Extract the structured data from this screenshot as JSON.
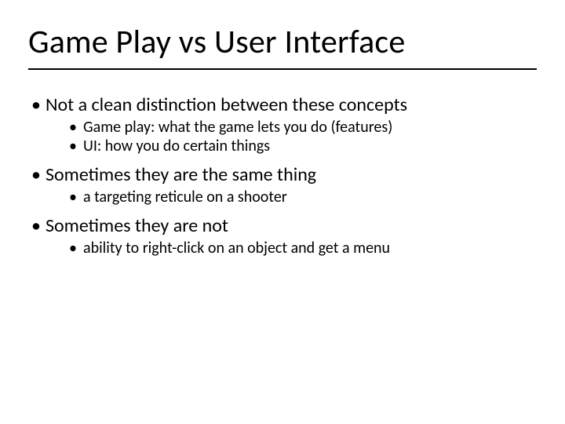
{
  "title": "Game Play vs User Interface",
  "bullets": [
    {
      "text": "Not a clean distinction between these concepts",
      "sub": [
        "Game play:  what the game lets you do (features)",
        " UI:  how you do certain things"
      ]
    },
    {
      "text": "Sometimes they are the same thing",
      "sub": [
        "a targeting reticule on a shooter"
      ]
    },
    {
      "text": "Sometimes they are not",
      "sub": [
        "ability to right-click on an object and get a menu"
      ]
    }
  ]
}
